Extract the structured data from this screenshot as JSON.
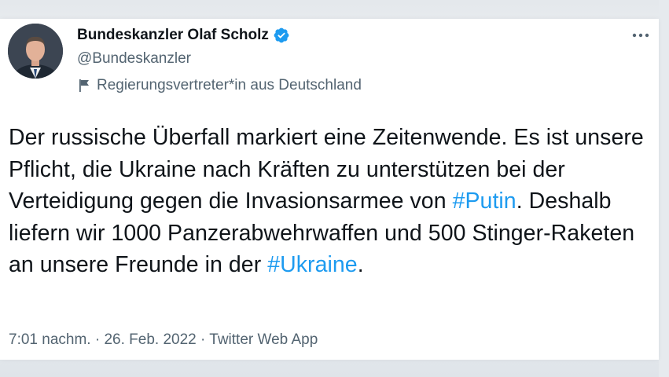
{
  "author": {
    "display_name": "Bundeskanzler Olaf Scholz",
    "handle": "@Bundeskanzler",
    "verified_icon": "verified-badge-icon",
    "gov_label": "Regierungsvertreter*in aus Deutschland",
    "gov_icon": "flag-icon"
  },
  "more_icon": "more-horizontal-icon",
  "tweet": {
    "segments": [
      {
        "type": "text",
        "text": "Der russische Überfall markiert eine Zeitenwende. Es ist unsere Pflicht, die Ukraine nach Kräften zu unterstützen bei der Verteidigung gegen die Invasionsarmee von "
      },
      {
        "type": "hashtag",
        "text": "#Putin"
      },
      {
        "type": "text",
        "text": ". Deshalb liefern wir 1000 Panzerabwehrwaffen und 500 Stinger-Raketen an unsere Freunde in der "
      },
      {
        "type": "hashtag",
        "text": "#Ukraine"
      },
      {
        "type": "text",
        "text": "."
      }
    ]
  },
  "meta": {
    "time": "7:01 nachm.",
    "separator": " · ",
    "date": "26. Feb. 2022",
    "source": "Twitter Web App"
  },
  "colors": {
    "link": "#1d9bf0",
    "secondary_text": "#536471",
    "verified": "#1d9bf0"
  }
}
